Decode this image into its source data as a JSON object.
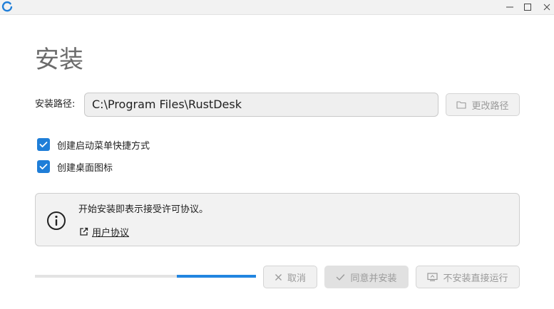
{
  "titlebar": {
    "icons": {
      "logo": "rustdesk-logo-icon",
      "minimize": "minimize-icon",
      "maximize": "maximize-icon",
      "close": "close-icon"
    },
    "accent_color": "#1f7ed8"
  },
  "main": {
    "title": "安装",
    "install_path": {
      "label": "安装路径:",
      "value": "C:\\Program Files\\RustDesk",
      "change_button": {
        "label": "更改路径",
        "icon": "folder-icon"
      }
    },
    "options": [
      {
        "label": "创建启动菜单快捷方式",
        "checked": true
      },
      {
        "label": "创建桌面图标",
        "checked": true
      }
    ],
    "notice": {
      "icon": "info-icon",
      "text": "开始安装即表示接受许可协议。",
      "link": {
        "label": "用户协议",
        "icon": "external-link-icon"
      }
    }
  },
  "footer": {
    "progress": {
      "indeterminate": true,
      "color": "#2185e0"
    },
    "buttons": {
      "cancel": {
        "label": "取消",
        "icon": "close-icon"
      },
      "install": {
        "label": "同意并安装",
        "icon": "check-icon"
      },
      "run_without_install": {
        "label": "不安装直接运行",
        "icon": "monitor-icon"
      }
    }
  }
}
